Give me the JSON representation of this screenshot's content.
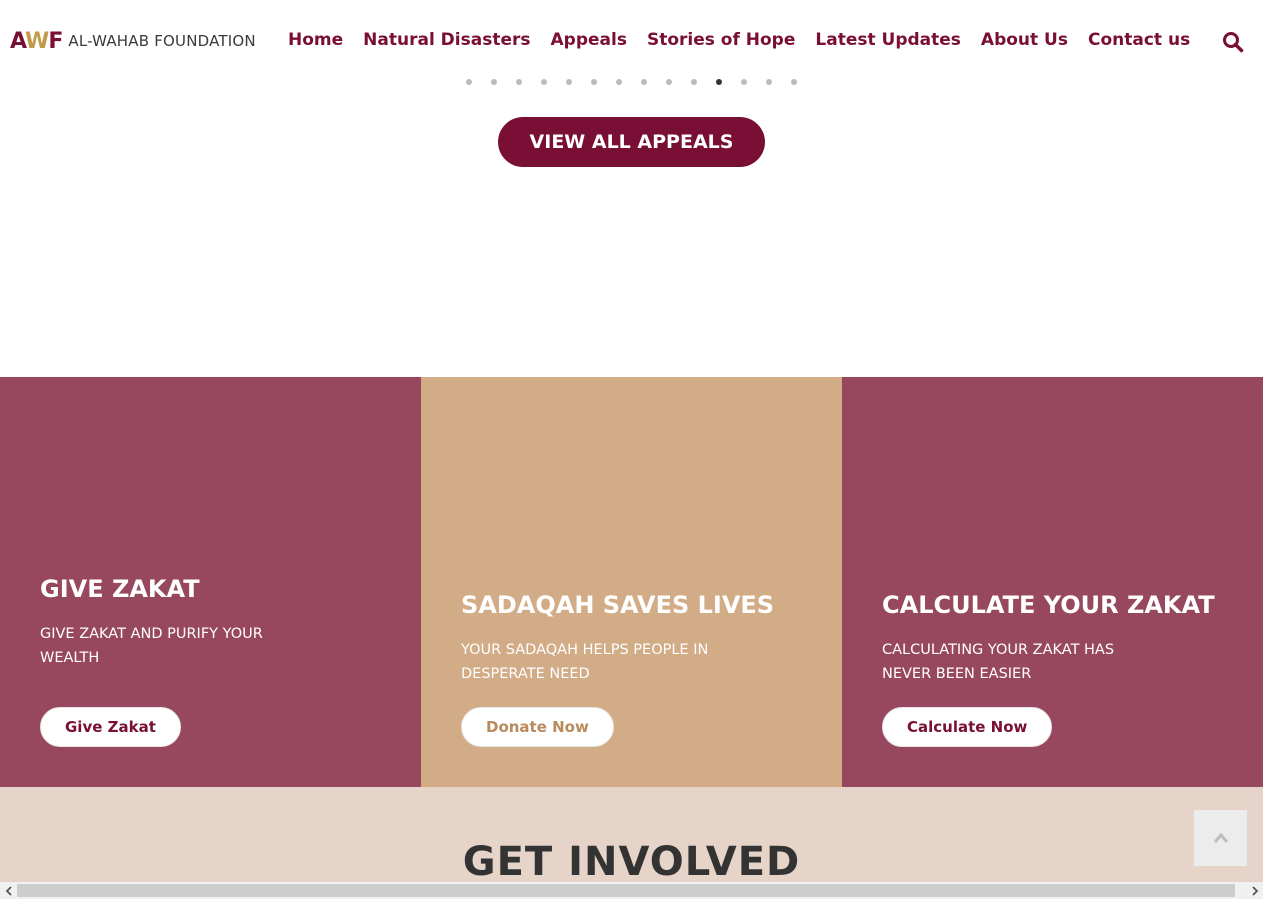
{
  "header": {
    "logo_mark": "AWF",
    "logo_text": "AL-WAHAB FOUNDATION",
    "nav": [
      {
        "label": "Home"
      },
      {
        "label": "Natural Disasters"
      },
      {
        "label": "Appeals"
      },
      {
        "label": "Stories of Hope"
      },
      {
        "label": "Latest Updates"
      },
      {
        "label": "About Us"
      },
      {
        "label": "Contact us"
      }
    ],
    "search_icon": "search-icon"
  },
  "carousel": {
    "dot_count": 14,
    "active_index": 10
  },
  "appeals": {
    "view_all_label": "VIEW ALL APPEALS"
  },
  "panels": [
    {
      "title": "GIVE ZAKAT",
      "subtitle": "GIVE ZAKAT AND PURIFY YOUR WEALTH",
      "button": "Give Zakat",
      "color": "#97485f"
    },
    {
      "title": "SADAQAH SAVES LIVES",
      "subtitle": "YOUR SADAQAH HELPS PEOPLE IN DESPERATE NEED",
      "button": "Donate Now",
      "color": "#d2ab87"
    },
    {
      "title": "CALCULATE YOUR ZAKAT",
      "subtitle": "CALCULATING YOUR ZAKAT HAS NEVER BEEN EASIER",
      "button": "Calculate Now",
      "color": "#97485f"
    }
  ],
  "involved": {
    "title": "GET INVOLVED"
  },
  "colors": {
    "brand": "#7a0f35",
    "gold": "#c49a4b"
  },
  "icons": {
    "scroll_top": "chevron-up-icon",
    "scroll_left": "chevron-left-icon",
    "scroll_right": "chevron-right-icon"
  }
}
